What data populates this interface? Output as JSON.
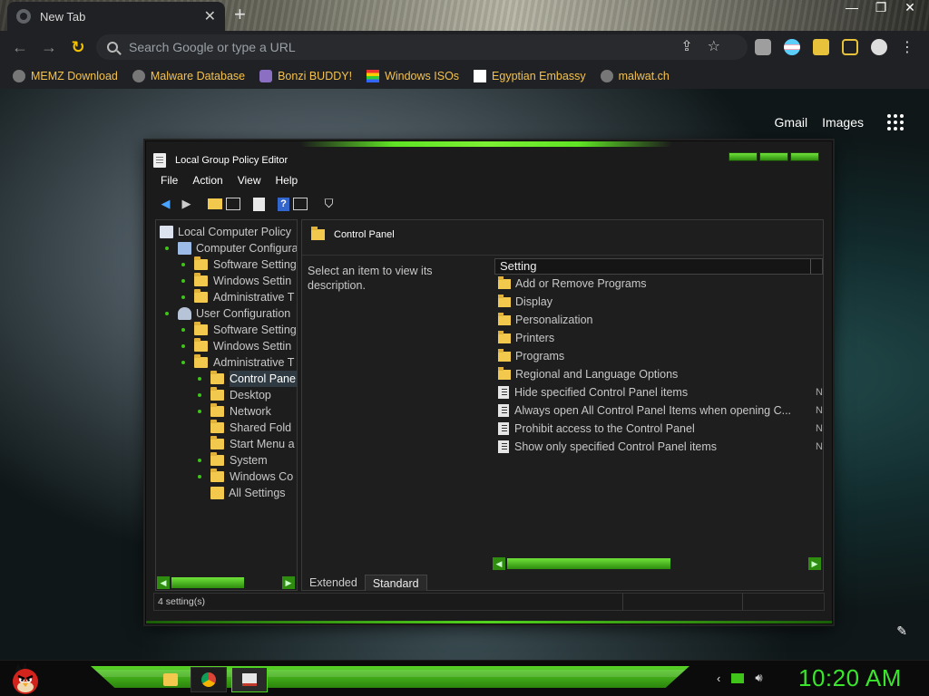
{
  "browser": {
    "tab_title": "New Tab",
    "new_tab_symbol": "+",
    "window_controls": [
      "—",
      "❐",
      "✕"
    ],
    "omnibox_placeholder": "Search Google or type a URL",
    "bookmarks": [
      {
        "label": "MEMZ Download",
        "icon": "globe-icon"
      },
      {
        "label": "Malware Database",
        "icon": "globe-icon"
      },
      {
        "label": "Bonzi BUDDY!",
        "icon": "bonzi-icon"
      },
      {
        "label": "Windows ISOs",
        "icon": "windows-flag-icon"
      },
      {
        "label": "Egyptian Embassy",
        "icon": "wix-icon"
      },
      {
        "label": "malwat.ch",
        "icon": "globe-icon"
      }
    ],
    "bookmark_color": "#f5c24b",
    "google_links": {
      "gmail": "Gmail",
      "images": "Images"
    }
  },
  "gpedit": {
    "title": "Local Group Policy Editor",
    "menu": [
      "File",
      "Action",
      "View",
      "Help"
    ],
    "tree": [
      {
        "label": "Local Computer Policy",
        "indent": 0,
        "icon": "policy"
      },
      {
        "label": "Computer Configura",
        "indent": 1,
        "icon": "computer"
      },
      {
        "label": "Software Setting",
        "indent": 2,
        "icon": "folder"
      },
      {
        "label": "Windows Settin",
        "indent": 2,
        "icon": "folder"
      },
      {
        "label": "Administrative T",
        "indent": 2,
        "icon": "folder"
      },
      {
        "label": "User Configuration",
        "indent": 1,
        "icon": "user"
      },
      {
        "label": "Software Setting",
        "indent": 2,
        "icon": "folder"
      },
      {
        "label": "Windows Settin",
        "indent": 2,
        "icon": "folder"
      },
      {
        "label": "Administrative T",
        "indent": 2,
        "icon": "folder"
      },
      {
        "label": "Control Pane",
        "indent": 3,
        "icon": "folder",
        "selected": true
      },
      {
        "label": "Desktop",
        "indent": 3,
        "icon": "folder"
      },
      {
        "label": "Network",
        "indent": 3,
        "icon": "folder"
      },
      {
        "label": "Shared Fold",
        "indent": 3,
        "icon": "folder"
      },
      {
        "label": "Start Menu a",
        "indent": 3,
        "icon": "folder"
      },
      {
        "label": "System",
        "indent": 3,
        "icon": "folder"
      },
      {
        "label": "Windows Co",
        "indent": 3,
        "icon": "folder"
      },
      {
        "label": "All Settings",
        "indent": 3,
        "icon": "settings"
      }
    ],
    "selected_node_title": "Control Panel",
    "description": "Select an item to view its description.",
    "column_header": "Setting",
    "items": [
      {
        "label": "Add or Remove Programs",
        "type": "folder",
        "state": ""
      },
      {
        "label": "Display",
        "type": "folder",
        "state": ""
      },
      {
        "label": "Personalization",
        "type": "folder",
        "state": ""
      },
      {
        "label": "Printers",
        "type": "folder",
        "state": ""
      },
      {
        "label": "Programs",
        "type": "folder",
        "state": ""
      },
      {
        "label": "Regional and Language Options",
        "type": "folder",
        "state": ""
      },
      {
        "label": "Hide specified Control Panel items",
        "type": "policy",
        "state": "N"
      },
      {
        "label": "Always open All Control Panel Items when opening C...",
        "type": "policy",
        "state": "N"
      },
      {
        "label": "Prohibit access to the Control Panel",
        "type": "policy",
        "state": "N"
      },
      {
        "label": "Show only specified Control Panel items",
        "type": "policy",
        "state": "N"
      }
    ],
    "view_tabs": [
      "Extended",
      "Standard"
    ],
    "active_view_tab": "Standard",
    "status": "4 setting(s)",
    "accent": "#4cd41f"
  },
  "taskbar": {
    "clock": "10:20 AM",
    "clock_color": "#39e62c",
    "apps": [
      "file-explorer-icon",
      "chrome-icon",
      "gpedit-icon"
    ]
  }
}
